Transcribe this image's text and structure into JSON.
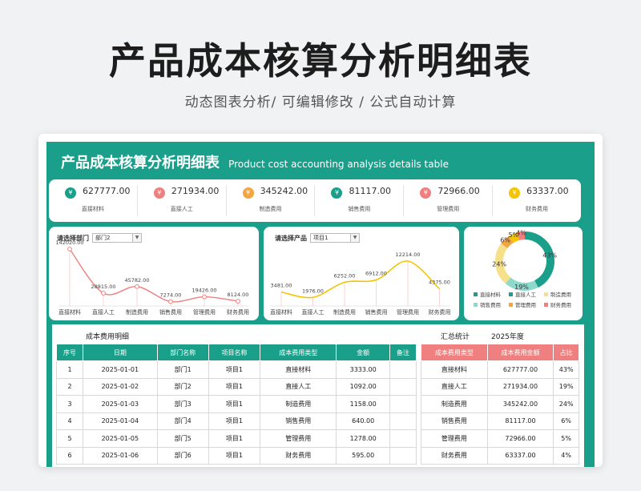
{
  "page": {
    "title": "产品成本核算分析明细表",
    "subtitle": "动态图表分析/  可编辑修改  / 公式自动计算"
  },
  "sheet": {
    "title_cn": "产品成本核算分析明细表",
    "title_en": "Product cost accounting analysis details table"
  },
  "colors": {
    "teal": "#1aa08a",
    "salmon": "#f07f7f",
    "orange": "#f2a541",
    "yellow": "#f5c400",
    "light_teal": "#8ed9cc",
    "pale_yellow": "#f6e08a"
  },
  "kpis": [
    {
      "value": "627777.00",
      "label": "直接材料",
      "color": "#1aa08a",
      "icon": "coin-icon"
    },
    {
      "value": "271934.00",
      "label": "直接人工",
      "color": "#f07f7f",
      "icon": "coin-icon"
    },
    {
      "value": "345242.00",
      "label": "制造费用",
      "color": "#f2a541",
      "icon": "coin-icon"
    },
    {
      "value": "81117.00",
      "label": "销售费用",
      "color": "#1aa08a",
      "icon": "coin-icon"
    },
    {
      "value": "72966.00",
      "label": "管理费用",
      "color": "#f07f7f",
      "icon": "coin-icon"
    },
    {
      "value": "63337.00",
      "label": "财务费用",
      "color": "#f5c400",
      "icon": "coin-icon"
    }
  ],
  "dept_panel": {
    "label": "请选择部门",
    "selected": "部门2"
  },
  "product_panel": {
    "label": "请选择产品",
    "selected": "项目1"
  },
  "chart_data": [
    {
      "type": "line",
      "categories": [
        "直接材料",
        "直接人工",
        "制造费用",
        "销售费用",
        "管理费用",
        "财务费用"
      ],
      "values": [
        142020,
        28815,
        45782,
        7274,
        19426,
        8124
      ],
      "data_labels": [
        "142020.00",
        "28815.00",
        "45782.00",
        "7274.00",
        "19426.00",
        "8124.00"
      ],
      "color": "#f07f7f"
    },
    {
      "type": "line",
      "categories": [
        "直接材料",
        "直接人工",
        "制造费用",
        "销售费用",
        "管理费用",
        "财务费用"
      ],
      "values": [
        3481,
        1976,
        6252,
        6912,
        12214,
        4375
      ],
      "data_labels": [
        "3481.00",
        "1976.00",
        "6252.00",
        "6912.00",
        "12214.00",
        "4375.00"
      ],
      "color": "#f5c400"
    },
    {
      "type": "pie",
      "categories": [
        "直接材料",
        "直接人工",
        "制造费用",
        "销售费用",
        "管理费用",
        "财务费用"
      ],
      "values": [
        43,
        19,
        24,
        6,
        5,
        4
      ],
      "data_labels": [
        "43%",
        "19%",
        "24%",
        "6%",
        "5%",
        "4%"
      ],
      "colors": [
        "#1aa08a",
        "#8ed9cc",
        "#f6e08a",
        "#f2a541",
        "#f5c400",
        "#f07f7f"
      ],
      "legend_colors": [
        "#1aa08a",
        "#1aa08a",
        "#f6e08a",
        "#8ed9cc",
        "#f2a541",
        "#f07f7f"
      ],
      "legend": "bottom"
    }
  ],
  "detail": {
    "title": "成本费用明细",
    "headers": [
      "序号",
      "日期",
      "部门名称",
      "项目名称",
      "成本费用类型",
      "金额",
      "备注"
    ],
    "rows": [
      [
        "1",
        "2025-01-01",
        "部门1",
        "项目1",
        "直接材料",
        "3333.00",
        ""
      ],
      [
        "2",
        "2025-01-02",
        "部门2",
        "项目1",
        "直接人工",
        "1092.00",
        ""
      ],
      [
        "3",
        "2025-01-03",
        "部门3",
        "项目1",
        "制造费用",
        "1158.00",
        ""
      ],
      [
        "4",
        "2025-01-04",
        "部门4",
        "项目1",
        "销售费用",
        "640.00",
        ""
      ],
      [
        "5",
        "2025-01-05",
        "部门5",
        "项目1",
        "管理费用",
        "1278.00",
        ""
      ],
      [
        "6",
        "2025-01-06",
        "部门6",
        "项目1",
        "财务费用",
        "595.00",
        ""
      ]
    ]
  },
  "summary": {
    "title": "汇总统计",
    "year": "2025年度",
    "headers": [
      "成本费用类型",
      "成本费用金额",
      "占比"
    ],
    "rows": [
      [
        "直接材料",
        "627777.00",
        "43%"
      ],
      [
        "直接人工",
        "271934.00",
        "19%"
      ],
      [
        "制造费用",
        "345242.00",
        "24%"
      ],
      [
        "销售费用",
        "81117.00",
        "6%"
      ],
      [
        "管理费用",
        "72966.00",
        "5%"
      ],
      [
        "财务费用",
        "63337.00",
        "4%"
      ]
    ]
  }
}
